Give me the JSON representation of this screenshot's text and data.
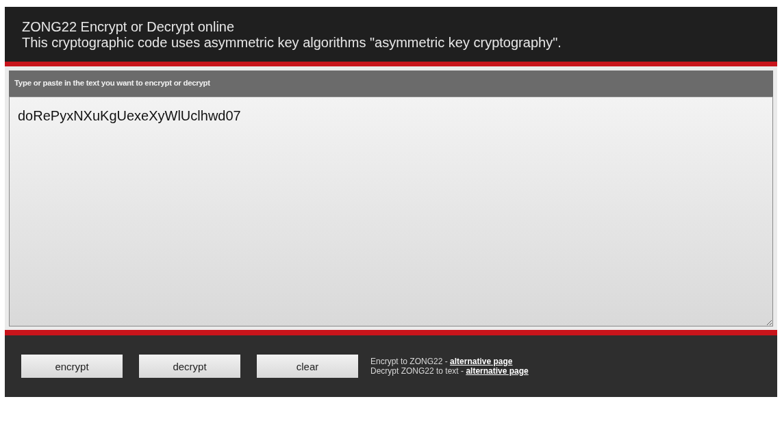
{
  "header": {
    "title": "ZONG22 Encrypt or Decrypt online",
    "subtitle": "This cryptographic code uses asymmetric key algorithms \"asymmetric key cryptography\"."
  },
  "input_panel": {
    "label": "Type or paste in the text you want to encrypt or decrypt",
    "value": "doRePyxNXuKgUexeXyWlUclhwd07"
  },
  "buttons": [
    {
      "label": "encrypt"
    },
    {
      "label": "decrypt"
    },
    {
      "label": "clear"
    }
  ],
  "links": [
    {
      "text": "Encrypt to ZONG22 - ",
      "link": "alternative page"
    },
    {
      "text": "Decrypt ZONG22 to text - ",
      "link": "alternative page"
    }
  ]
}
